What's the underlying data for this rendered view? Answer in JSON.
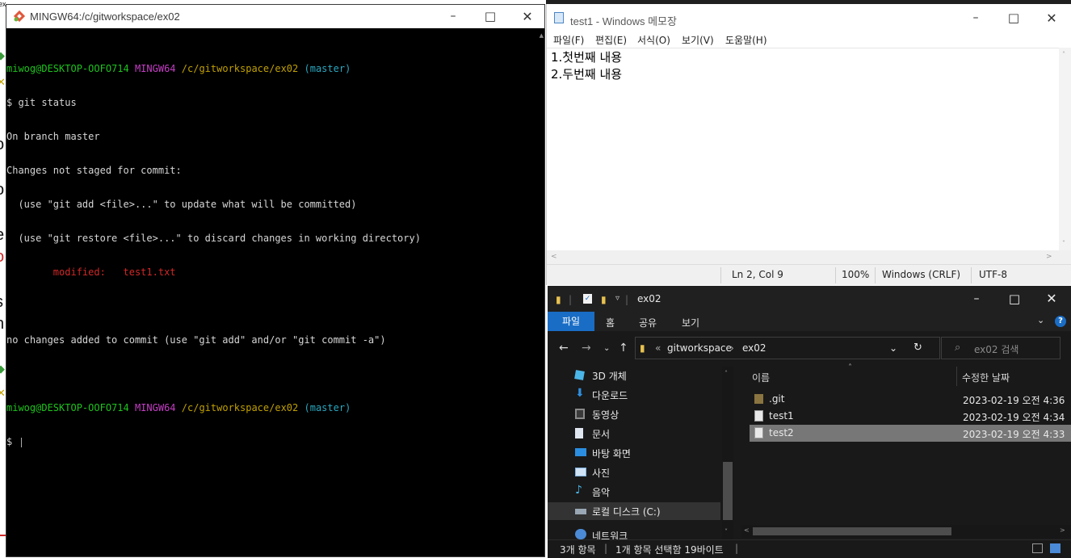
{
  "background": {
    "fragments": [
      "ex",
      "t",
      "o",
      "i",
      "o",
      "i",
      "e",
      "o",
      "s",
      "n"
    ]
  },
  "terminal": {
    "title": "MINGW64:/c/gitworkspace/ex02",
    "prompt1": {
      "user": "miwog@DESKTOP-OOFO714",
      "shell": "MINGW64",
      "path": "/c/gitworkspace/ex02",
      "branch": "(master)"
    },
    "command": "$ git status",
    "output": [
      "On branch master",
      "Changes not staged for commit:",
      "  (use \"git add <file>...\" to update what will be committed)",
      "  (use \"git restore <file>...\" to discard changes in working directory)"
    ],
    "modified_label": "        modified:   test1.txt",
    "summary": "no changes added to commit (use \"git add\" and/or \"git commit -a\")",
    "prompt2": {
      "user": "miwog@DESKTOP-OOFO714",
      "shell": "MINGW64",
      "path": "/c/gitworkspace/ex02",
      "branch": "(master)"
    },
    "input": "$ "
  },
  "notepad": {
    "title": "test1 - Windows 메모장",
    "menu": [
      "파일(F)",
      "편집(E)",
      "서식(O)",
      "보기(V)",
      "도움말(H)"
    ],
    "lines": [
      "1.첫번째 내용",
      "2.두번째 내용"
    ],
    "status": {
      "position": "Ln 2, Col 9",
      "zoom": "100%",
      "line_ending": "Windows (CRLF)",
      "encoding": "UTF-8"
    }
  },
  "explorer": {
    "title": "ex02",
    "ribbon_tabs": [
      "파일",
      "홈",
      "공유",
      "보기"
    ],
    "address": {
      "prefix": "«",
      "parts": [
        "gitworkspace",
        "ex02"
      ],
      "separator": "›"
    },
    "search_placeholder": "ex02 검색",
    "nav_items": [
      {
        "label": "3D 개체",
        "icon": "3d-objects-icon"
      },
      {
        "label": "다운로드",
        "icon": "download-icon"
      },
      {
        "label": "동영상",
        "icon": "video-icon"
      },
      {
        "label": "문서",
        "icon": "document-icon"
      },
      {
        "label": "바탕 화면",
        "icon": "desktop-icon"
      },
      {
        "label": "사진",
        "icon": "pictures-icon"
      },
      {
        "label": "음악",
        "icon": "music-icon"
      },
      {
        "label": "로컬 디스크 (C:)",
        "icon": "drive-icon"
      },
      {
        "label": "네트워크",
        "icon": "network-icon"
      }
    ],
    "columns": {
      "name": "이름",
      "modified": "수정한 날짜"
    },
    "files": [
      {
        "name": ".git",
        "modified": "2023-02-19 오전 4:36",
        "type": "folder"
      },
      {
        "name": "test1",
        "modified": "2023-02-19 오전 4:34",
        "type": "file"
      },
      {
        "name": "test2",
        "modified": "2023-02-19 오전 4:33",
        "type": "file",
        "selected": true
      }
    ],
    "status": {
      "count": "3개 항목",
      "selection": "1개 항목 선택함 19바이트"
    }
  },
  "colors": {
    "git_user": "#1ec41e",
    "git_shell": "#c53ec5",
    "git_path": "#c0a000",
    "git_branch": "#2aa8c0",
    "git_modified": "#d12828",
    "explorer_accent": "#1a6dc5"
  }
}
